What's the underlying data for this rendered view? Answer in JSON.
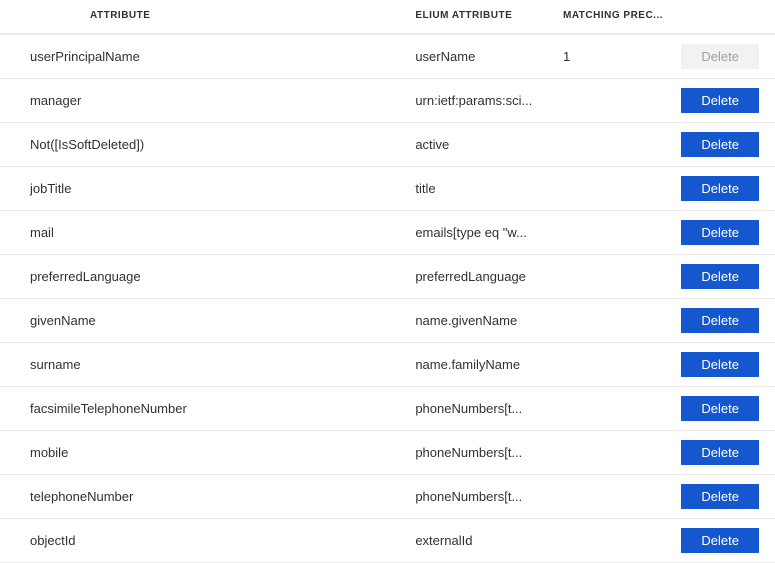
{
  "headers": {
    "attribute": "ATTRIBUTE",
    "elium": "ELIUM ATTRIBUTE",
    "precedence": "MATCHING PREC..."
  },
  "buttons": {
    "delete": "Delete"
  },
  "rows": [
    {
      "attribute": "userPrincipalName",
      "elium": "userName",
      "precedence": "1",
      "deleteEnabled": false
    },
    {
      "attribute": "manager",
      "elium": "urn:ietf:params:sci...",
      "precedence": "",
      "deleteEnabled": true
    },
    {
      "attribute": "Not([IsSoftDeleted])",
      "elium": "active",
      "precedence": "",
      "deleteEnabled": true
    },
    {
      "attribute": "jobTitle",
      "elium": "title",
      "precedence": "",
      "deleteEnabled": true
    },
    {
      "attribute": "mail",
      "elium": "emails[type eq \"w...",
      "precedence": "",
      "deleteEnabled": true
    },
    {
      "attribute": "preferredLanguage",
      "elium": "preferredLanguage",
      "precedence": "",
      "deleteEnabled": true
    },
    {
      "attribute": "givenName",
      "elium": "name.givenName",
      "precedence": "",
      "deleteEnabled": true
    },
    {
      "attribute": "surname",
      "elium": "name.familyName",
      "precedence": "",
      "deleteEnabled": true
    },
    {
      "attribute": "facsimileTelephoneNumber",
      "elium": "phoneNumbers[t...",
      "precedence": "",
      "deleteEnabled": true
    },
    {
      "attribute": "mobile",
      "elium": "phoneNumbers[t...",
      "precedence": "",
      "deleteEnabled": true
    },
    {
      "attribute": "telephoneNumber",
      "elium": "phoneNumbers[t...",
      "precedence": "",
      "deleteEnabled": true
    },
    {
      "attribute": "objectId",
      "elium": "externalId",
      "precedence": "",
      "deleteEnabled": true
    }
  ]
}
